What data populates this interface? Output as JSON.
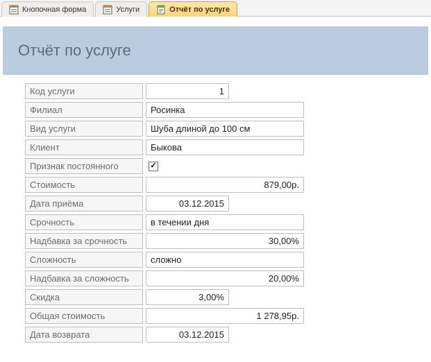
{
  "tabs": [
    {
      "label": "Кнопочная форма",
      "type": "form",
      "active": false
    },
    {
      "label": "Услуги",
      "type": "form",
      "active": false
    },
    {
      "label": "Отчёт по услуге",
      "type": "report",
      "active": true
    }
  ],
  "report": {
    "title": "Отчёт по услуге",
    "fields": {
      "service_code": {
        "label": "Код услуги",
        "value": "1"
      },
      "branch": {
        "label": "Филиал",
        "value": "Росинка"
      },
      "service_type": {
        "label": "Вид услуги",
        "value": "Шуба длиной  до 100 см"
      },
      "client": {
        "label": "Клиент",
        "value": "Быкова"
      },
      "regular_flag": {
        "label": "Признак постоянного",
        "checked": true
      },
      "cost": {
        "label": "Стоимость",
        "value": "879,00р."
      },
      "intake_date": {
        "label": "Дата приёма",
        "value": "03.12.2015"
      },
      "urgency": {
        "label": "Срочность",
        "value": "в течении дня"
      },
      "urgency_surcharge": {
        "label": "Надбавка за срочность",
        "value": "30,00%"
      },
      "complexity": {
        "label": "Сложность",
        "value": "сложно"
      },
      "complexity_surcharge": {
        "label": "Надбавка за сложность",
        "value": "20,00%"
      },
      "discount": {
        "label": "Скидка",
        "value": "3,00%"
      },
      "total_cost": {
        "label": "Общая стоимость",
        "value": "1 278,95р."
      },
      "return_date": {
        "label": "Дата возврата",
        "value": "03.12.2015"
      }
    }
  }
}
